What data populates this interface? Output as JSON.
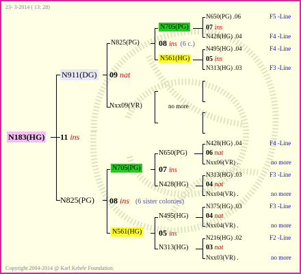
{
  "header": {
    "timestamp": "23- 3-2014 ( 13: 28)"
  },
  "footer": {
    "copyright": "Copyright 2004-2014 @ Karl Kehrle Foundation."
  },
  "colors": {
    "border": "#e020a0",
    "background": "#ffffe4",
    "green_highlight": "#22cc22",
    "yellow_highlight": "#ffff22",
    "root_highlight": "#f2c0f2",
    "line_label": "#1010c0",
    "mating": "#e00000"
  },
  "tree": {
    "root": {
      "name": "N183(HG)",
      "year": "11",
      "mating": "ins"
    },
    "father": {
      "name": "N911(DG)",
      "year": "09",
      "mating": "nat"
    },
    "mother": {
      "name": "N825(PG)",
      "year": "08",
      "mating": "ins",
      "note": "(6 sister colonies)"
    },
    "ff": {
      "name": "N825(PG)",
      "year": "08",
      "mating": "ins",
      "note": "(6 c.)"
    },
    "fm": {
      "name": "Nxx09(VR)",
      "note": "no more"
    },
    "fff": {
      "name": "N705(PG)",
      "year": "07",
      "mating": "ins"
    },
    "ffm": {
      "name": "N561(HG)",
      "year": "05",
      "mating": "ins"
    },
    "mf": {
      "name": "N705(PG)",
      "year": "07",
      "mating": "ins"
    },
    "mm": {
      "name": "N561(HG)",
      "year": "05",
      "mating": "ins"
    },
    "mff": {
      "name": "N650(PG)",
      "year": "06",
      "mating": "nat"
    },
    "mfm": {
      "name": "N428(HG)",
      "year": "04",
      "mating": "nat"
    },
    "mmf": {
      "name": "N495(HG)",
      "year": "04",
      "mating": "nat"
    },
    "mmm": {
      "name": "N313(HG)",
      "year": "03",
      "mating": "nat"
    }
  },
  "right_column": [
    {
      "name": "N650(PG)",
      "num": ".06",
      "line": "F5 -Line"
    },
    {
      "name": "07",
      "mating": "ins"
    },
    {
      "name": "N428(HG)",
      "num": ".04",
      "line": "F4 -Line"
    },
    {
      "name": "N495(HG)",
      "num": ".04",
      "line": "F4 -Line"
    },
    {
      "name": "05",
      "mating": "ins"
    },
    {
      "name": "N313(HG)",
      "num": ".03",
      "line": "F3 -Line"
    },
    {
      "name": "N428(HG)",
      "num": ".04",
      "line": "F4 -Line"
    },
    {
      "name": "Nxx06(VR)",
      "num": ".",
      "line": "no more"
    },
    {
      "name": "N313(HG)",
      "num": ".03",
      "line": "F3 -Line"
    },
    {
      "name": "Nxx04(VR)",
      "num": ".",
      "line": "no more"
    },
    {
      "name": "N375(HG)",
      "num": ".03",
      "line": "F3 -Line"
    },
    {
      "name": "Nxx04(VR)",
      "num": ".",
      "line": "no more"
    },
    {
      "name": "N216(HG)",
      "num": ".02",
      "line": "F2 -Line"
    },
    {
      "name": "Nxx03(VR)",
      "num": ".",
      "line": "no more"
    }
  ]
}
